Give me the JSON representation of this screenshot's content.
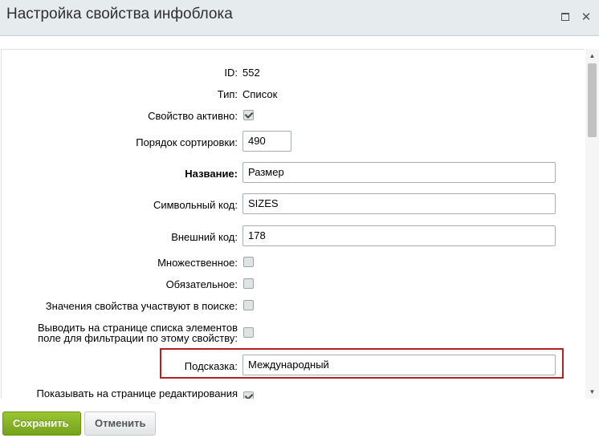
{
  "window": {
    "title": "Настройка свойства инфоблока"
  },
  "form": {
    "id": {
      "label": "ID:",
      "value": "552"
    },
    "type": {
      "label": "Тип:",
      "value": "Список"
    },
    "active": {
      "label": "Свойство активно:",
      "checked": true
    },
    "sort": {
      "label": "Порядок сортировки:",
      "value": "490"
    },
    "name": {
      "label": "Название:",
      "value": "Размер"
    },
    "code": {
      "label": "Символьный код:",
      "value": "SIZES"
    },
    "xml_id": {
      "label": "Внешний код:",
      "value": "178"
    },
    "multiple": {
      "label": "Множественное:",
      "checked": false
    },
    "required": {
      "label": "Обязательное:",
      "checked": false
    },
    "searchable": {
      "label": "Значения свойства участвуют в поиске:",
      "checked": false
    },
    "filtrable": {
      "label": "Выводить на странице списка элементов поле для фильтрации по этому свойству:",
      "checked": false
    },
    "hint": {
      "label": "Подсказка:",
      "value": "Международный"
    },
    "show_edit": {
      "label": "Показывать на странице редактирования",
      "checked": true
    }
  },
  "footer": {
    "save_label": "Сохранить",
    "cancel_label": "Отменить"
  },
  "colors": {
    "save_button": "#84b022",
    "highlight_border": "#b22222",
    "titlebar_bg": "#e6ecee"
  }
}
